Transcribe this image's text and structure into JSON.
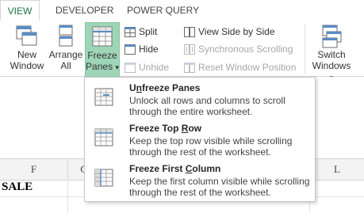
{
  "tabs": [
    {
      "label": "VIEW",
      "active": true
    },
    {
      "label": "DEVELOPER",
      "active": false
    },
    {
      "label": "POWER QUERY",
      "active": false
    }
  ],
  "ribbon": {
    "new_window": {
      "line1": "New",
      "line2": "Window"
    },
    "arrange_all": {
      "line1": "Arrange",
      "line2": "All"
    },
    "freeze_panes": {
      "line1": "Freeze",
      "line2": "Panes",
      "caret": "▾"
    },
    "split": "Split",
    "hide": "Hide",
    "unhide": "Unhide",
    "view_side_by_side": "View Side by Side",
    "synchronous_scrolling": "Synchronous Scrolling",
    "reset_window_position": "Reset Window Position",
    "switch_windows": {
      "line1": "Switch",
      "line2": "Windows",
      "caret": "▾"
    }
  },
  "menu": {
    "items": [
      {
        "title_pre": "U",
        "title_ul": "n",
        "title_post": "freeze Panes",
        "desc": "Unlock all rows and columns to scroll through the entire worksheet.",
        "icon": "unfreeze-panes-icon"
      },
      {
        "title_pre": "Freeze Top ",
        "title_ul": "R",
        "title_post": "ow",
        "desc": "Keep the top row visible while scrolling through the rest of the worksheet.",
        "icon": "freeze-top-row-icon"
      },
      {
        "title_pre": "Freeze First ",
        "title_ul": "C",
        "title_post": "olumn",
        "desc": "Keep the first column visible while scrolling through the rest of the worksheet.",
        "icon": "freeze-first-column-icon"
      }
    ]
  },
  "sheet": {
    "columns": [
      "F",
      "G",
      "L"
    ],
    "cell_text": "SALE"
  },
  "colors": {
    "accent": "#217346",
    "selected_button": "#9fd5b7"
  }
}
